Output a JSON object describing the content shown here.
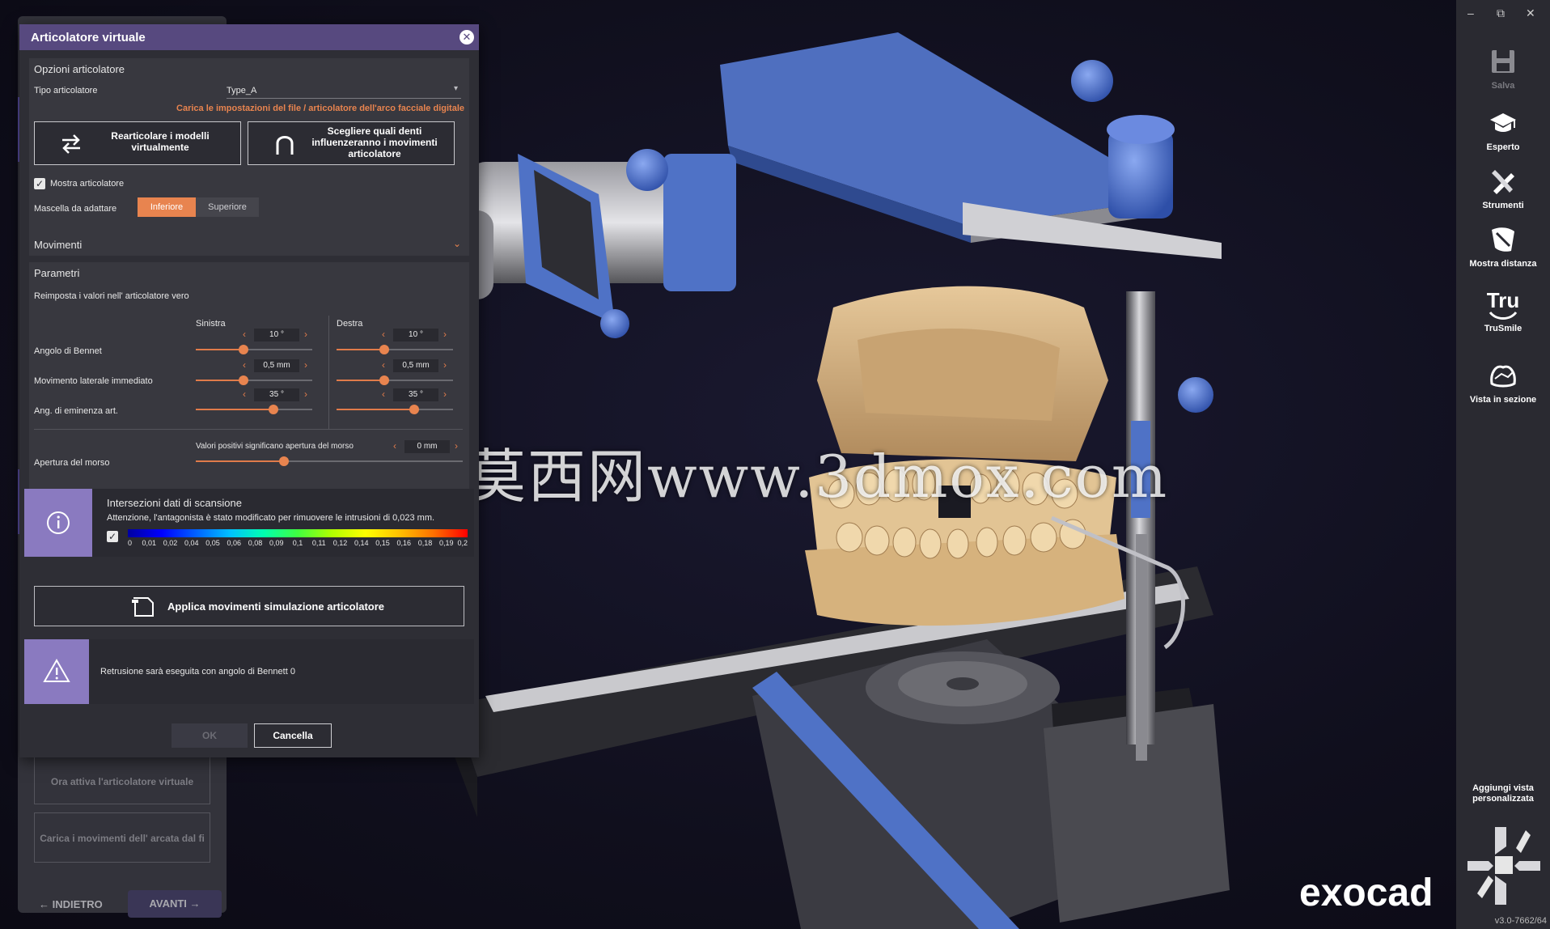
{
  "watermark": "莫西网www.3dmox.com",
  "brand": "exocad",
  "version": "v3.0-7662/64",
  "toolbar": {
    "items": [
      {
        "label": "Salva",
        "icon": "save-icon"
      },
      {
        "label": "Esperto",
        "icon": "graduation-cap-icon"
      },
      {
        "label": "Strumenti",
        "icon": "tools-icon"
      },
      {
        "label": "Mostra distanza",
        "icon": "distance-icon"
      },
      {
        "label": "TruSmile",
        "icon": "trusmile-icon"
      },
      {
        "label": "Vista in sezione",
        "icon": "section-view-icon"
      }
    ],
    "trusmile_logo": "Tru",
    "custom_view": "Aggiungi vista personalizzata"
  },
  "wizard": {
    "buttons": [
      "Ora attiva l'articolatore virtuale",
      "Carica i movimenti dell' arcata dal fi"
    ],
    "back": "INDIETRO",
    "next": "AVANTI"
  },
  "dialog": {
    "title": "Articolatore virtuale",
    "options": {
      "title": "Opzioni articolatore",
      "type_label": "Tipo articolatore",
      "type_value": "Type_A",
      "load_link": "Carica le impostazioni del file / articolatore dell'arco facciale digitale",
      "rearticulate": "Rearticolare i modelli virtualmente",
      "choose_teeth": "Scegliere quali denti influenzeranno i movimenti articolatore",
      "show_articulator": "Mostra articolatore",
      "jaw_label": "Mascella da adattare",
      "jaw_lower": "Inferiore",
      "jaw_upper": "Superiore"
    },
    "movements": "Movimenti",
    "params": {
      "title": "Parametri",
      "reset": "Reimposta i valori nell' articolatore vero",
      "left": "Sinistra",
      "right": "Destra",
      "rows": [
        {
          "label": "Angolo di Bennet",
          "left": "10 °",
          "right": "10 °",
          "left_pos": 0.41,
          "right_pos": 0.41
        },
        {
          "label": "Movimento laterale immediato",
          "left": "0,5 mm",
          "right": "0,5 mm",
          "left_pos": 0.41,
          "right_pos": 0.41
        },
        {
          "label": "Ang. di eminenza art.",
          "left": "35 °",
          "right": "35 °",
          "left_pos": 0.67,
          "right_pos": 0.67
        }
      ],
      "bite_label": "Apertura del morso",
      "bite_hint": "Valori positivi significano apertura del morso",
      "bite_value": "0 mm",
      "bite_pos": 0.33
    },
    "scan": {
      "title": "Intersezioni dati di scansione",
      "message": "Attenzione, l'antagonista è stato modificato per rimuovere le intrusioni di 0,023 mm.",
      "scale": [
        "0",
        "0,01",
        "0,02",
        "0,04",
        "0,05",
        "0,06",
        "0,08",
        "0,09",
        "0,1",
        "0,11",
        "0,12",
        "0,14",
        "0,15",
        "0,16",
        "0,18",
        "0,19",
        "0,2"
      ]
    },
    "apply": "Applica movimenti simulazione articolatore",
    "warning": "Retrusione sarà eseguita con angolo di Bennett 0",
    "ok": "OK",
    "cancel": "Cancella"
  },
  "colors": {
    "accent": "#e8844f",
    "title_bar": "#57497f",
    "info_box": "#8a7ac0",
    "articulator_blue": "#4f72c6",
    "model_tan": "#d8b687"
  }
}
